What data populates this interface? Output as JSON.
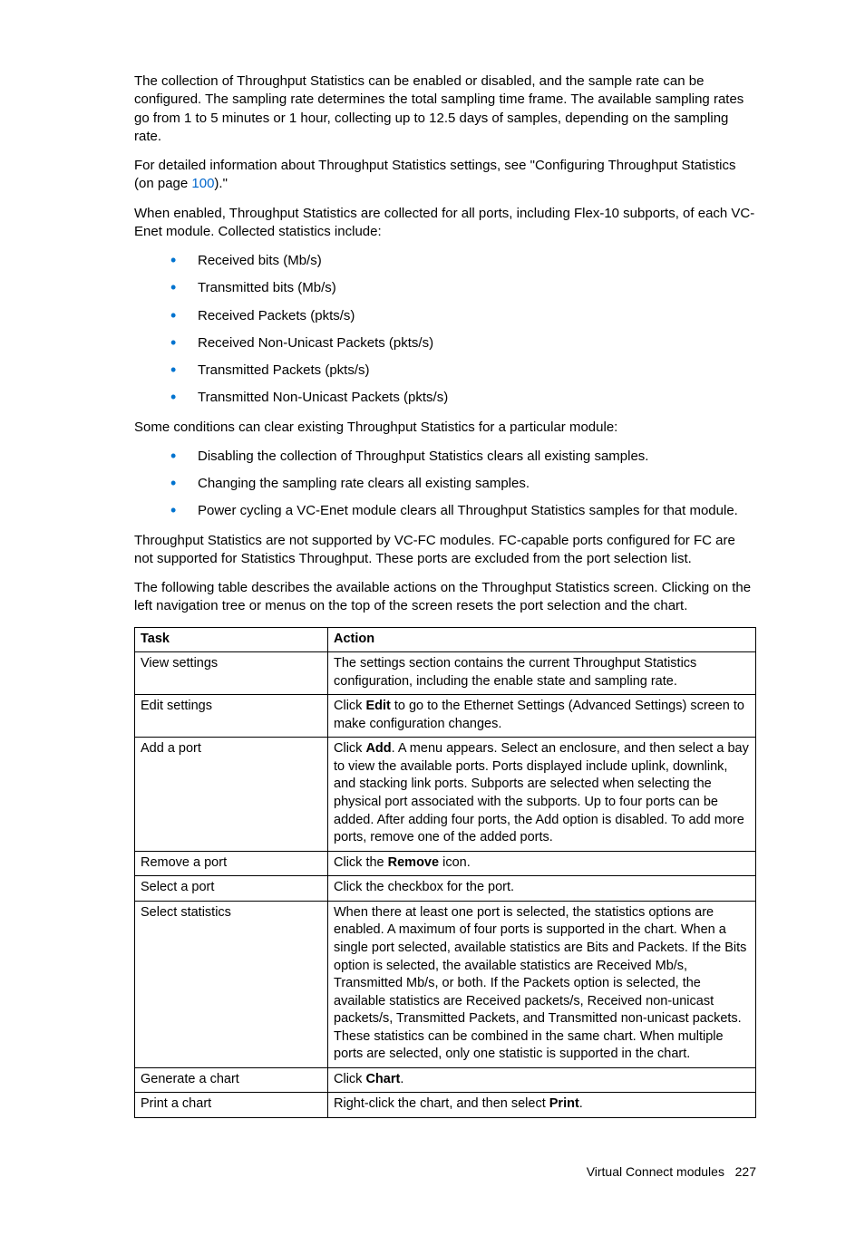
{
  "paragraphs": {
    "p1": "The collection of Throughput Statistics can be enabled or disabled, and the sample rate can be configured. The sampling rate determines the total sampling time frame. The available sampling rates go from 1 to 5 minutes or 1 hour, collecting up to 12.5 days of samples, depending on the sampling rate.",
    "p2_prefix": "For detailed information about Throughput Statistics settings, see \"Configuring Throughput Statistics (on page ",
    "p2_link": "100",
    "p2_suffix": ").\"",
    "p3": "When enabled, Throughput Statistics are collected for all ports, including Flex-10 subports, of each VC-Enet module. Collected statistics include:",
    "p4": "Some conditions can clear existing Throughput Statistics for a particular module:",
    "p5": "Throughput Statistics are not supported by VC-FC modules. FC-capable ports configured for FC are not supported for Statistics Throughput. These ports are excluded from the port selection list.",
    "p6": "The following table describes the available actions on the Throughput Statistics screen. Clicking on the left navigation tree or menus on the top of the screen resets the port selection and the chart."
  },
  "stats_list": [
    "Received bits (Mb/s)",
    "Transmitted bits (Mb/s)",
    "Received Packets (pkts/s)",
    "Received Non-Unicast Packets (pkts/s)",
    "Transmitted Packets (pkts/s)",
    "Transmitted Non-Unicast Packets (pkts/s)"
  ],
  "conditions_list": [
    "Disabling the collection of Throughput Statistics clears all existing samples.",
    "Changing the sampling rate clears all existing samples.",
    "Power cycling a VC-Enet module clears all Throughput Statistics samples for that module."
  ],
  "table": {
    "header_task": "Task",
    "header_action": "Action",
    "rows": [
      {
        "task": "View settings",
        "action_parts": [
          "The settings section contains the current Throughput Statistics configuration, including the enable state and sampling rate."
        ]
      },
      {
        "task": "Edit settings",
        "action_parts": [
          "Click ",
          {
            "b": "Edit"
          },
          " to go to   the Ethernet Settings (Advanced Settings) screen to make configuration changes."
        ]
      },
      {
        "task": "Add a port",
        "action_parts": [
          "Click ",
          {
            "b": "Add"
          },
          ". A menu appears. Select an enclosure, and then select a bay to view the available ports. Ports displayed include uplink, downlink, and stacking link ports. Subports are selected when selecting the physical port associated with the subports. Up to four ports can be added. After adding four ports, the Add option is disabled. To add more ports, remove one of the added ports."
        ]
      },
      {
        "task": "Remove a port",
        "action_parts": [
          "Click the ",
          {
            "b": "Remove"
          },
          " icon."
        ]
      },
      {
        "task": "Select a port",
        "action_parts": [
          "Click the checkbox for the port."
        ]
      },
      {
        "task": "Select statistics",
        "action_parts": [
          "When there at least one port is selected, the statistics options are enabled. A maximum of four ports is supported in the chart. When a single port selected, available statistics are Bits and Packets. If the Bits option is selected, the available statistics are Received Mb/s, Transmitted Mb/s, or both. If the Packets option is selected, the available statistics are Received packets/s, Received non-unicast packets/s, Transmitted Packets, and Transmitted non-unicast packets. These statistics can be combined in the same chart. When multiple ports are selected, only one statistic is supported in the chart."
        ]
      },
      {
        "task": "Generate a chart",
        "action_parts": [
          "Click ",
          {
            "b": "Chart"
          },
          "."
        ]
      },
      {
        "task": "Print a chart",
        "action_parts": [
          "Right-click the chart, and then select ",
          {
            "b": "Print"
          },
          "."
        ]
      }
    ]
  },
  "footer": {
    "section": "Virtual Connect modules",
    "page": "227"
  }
}
